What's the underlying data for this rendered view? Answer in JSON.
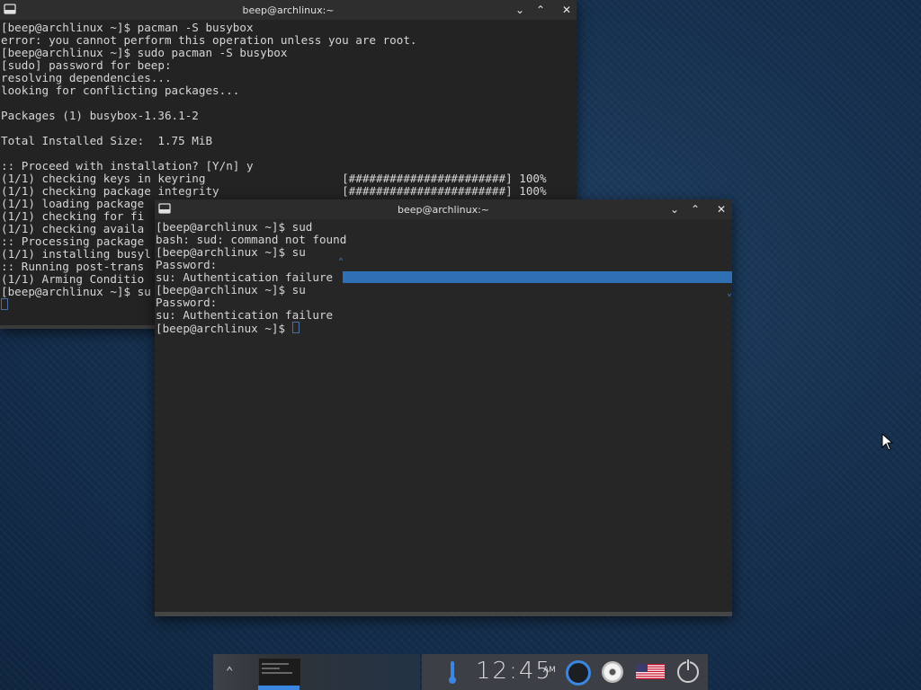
{
  "window_back": {
    "title": "beep@archlinux:~",
    "lines": [
      "[beep@archlinux ~]$ pacman -S busybox",
      "error: you cannot perform this operation unless you are root.",
      "[beep@archlinux ~]$ sudo pacman -S busybox",
      "[sudo] password for beep:",
      "resolving dependencies...",
      "looking for conflicting packages...",
      "",
      "Packages (1) busybox-1.36.1-2",
      "",
      "Total Installed Size:  1.75 MiB",
      "",
      ":: Proceed with installation? [Y/n] y",
      "(1/1) checking keys in keyring                    [#######################] 100%",
      "(1/1) checking package integrity                  [#######################] 100%",
      "(1/1) loading package",
      "(1/1) checking for fi",
      "(1/1) checking availa",
      ":: Processing package",
      "(1/1) installing busyl",
      ":: Running post-trans",
      "(1/1) Arming Conditio",
      "[beep@archlinux ~]$ su"
    ]
  },
  "window_front": {
    "title": "beep@archlinux:~",
    "lines": [
      "[beep@archlinux ~]$ sud",
      "bash: sud: command not found",
      "[beep@archlinux ~]$ su",
      "Password:",
      "su: Authentication failure",
      "[beep@archlinux ~]$ su",
      "Password:",
      "su: Authentication failure",
      "[beep@archlinux ~]$ "
    ]
  },
  "taskbar": {
    "clock": "12:45",
    "ampm": "AM"
  },
  "colors": {
    "accent": "#3b86e0",
    "selection": "#2f6fb3",
    "terminal_bg": "#232323",
    "terminal_fg": "#d6d6d6"
  },
  "icons": [
    "terminal-icon",
    "minimize-icon",
    "maximize-icon",
    "close-icon",
    "chevron-up-icon",
    "thermometer-icon",
    "ring-icon",
    "disc-icon",
    "us-flag-icon",
    "power-icon",
    "mouse-pointer-icon"
  ]
}
